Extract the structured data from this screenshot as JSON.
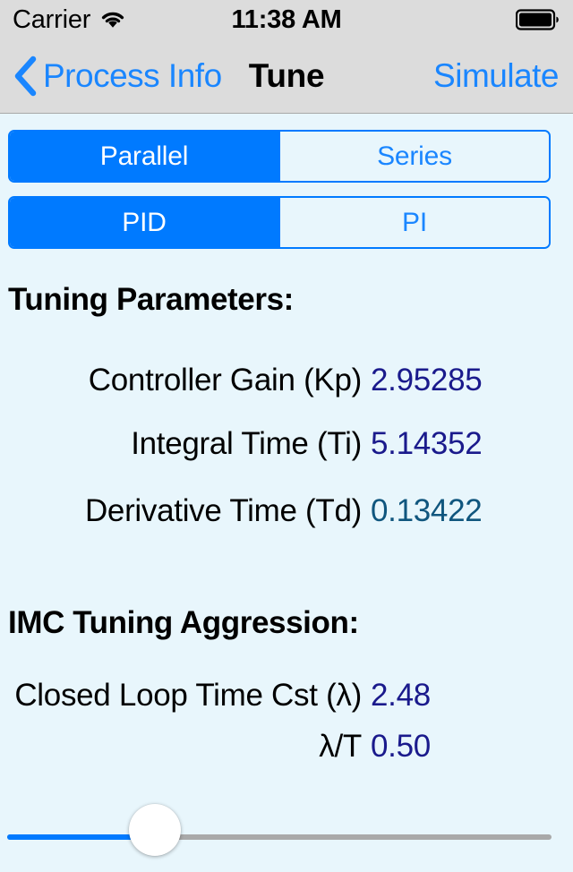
{
  "status_bar": {
    "carrier": "Carrier",
    "wifi_icon": "wifi-icon",
    "time": "11:38 AM",
    "battery_icon": "battery-full-icon"
  },
  "nav_bar": {
    "back_icon": "chevron-left-icon",
    "back_label": "Process Info",
    "title": "Tune",
    "right_action": "Simulate"
  },
  "segmented_controls": [
    {
      "name": "controller-form",
      "options": [
        {
          "label": "Parallel",
          "selected": true
        },
        {
          "label": "Series",
          "selected": false
        }
      ]
    },
    {
      "name": "controller-type",
      "options": [
        {
          "label": "PID",
          "selected": true
        },
        {
          "label": "PI",
          "selected": false
        }
      ]
    }
  ],
  "sections": [
    {
      "heading": "Tuning Parameters:",
      "rows": [
        {
          "label": "Controller Gain (Kp)",
          "value": "2.95285"
        },
        {
          "label": "Integral Time (Ti)",
          "value": "5.14352"
        },
        {
          "label": "Derivative Time (Td)",
          "value": "0.13422"
        }
      ]
    },
    {
      "heading": "IMC Tuning Aggression:",
      "rows": [
        {
          "label": "Closed Loop Time Cst (λ)",
          "value": "2.48"
        },
        {
          "label": "λ/T",
          "value": "0.50"
        }
      ]
    }
  ],
  "slider": {
    "name": "imc-aggression-slider",
    "fill_color": "#007aff",
    "track_color": "#a9a9a9",
    "thumb_color": "#ffffff"
  },
  "colors": {
    "page_background": "#e8f6fc",
    "chrome_background": "#dcdcdc",
    "accent_blue": "#007aff",
    "link_blue": "#1a86ff",
    "value_navy": "#1a1a8c",
    "value_teal": "#10567e"
  }
}
